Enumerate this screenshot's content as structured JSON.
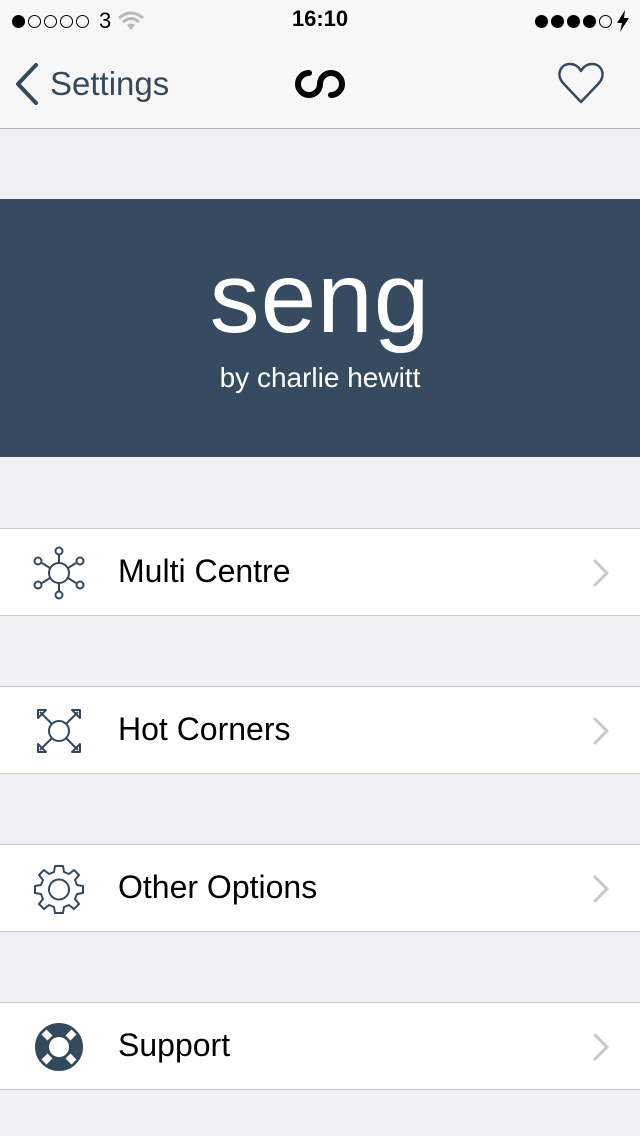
{
  "status_bar": {
    "signal_dots": [
      true,
      false,
      false,
      false,
      false
    ],
    "carrier": "3",
    "time": "16:10",
    "battery_dots": [
      true,
      true,
      true,
      true,
      false
    ],
    "icons": [
      "wifi-icon",
      "charging-bolt-icon"
    ]
  },
  "nav": {
    "back_label": "Settings",
    "logo": "seng-logo",
    "action_icon": "heart-icon"
  },
  "hero": {
    "title": "seng",
    "subtitle": "by charlie hewitt"
  },
  "menu": [
    {
      "label": "Multi Centre",
      "icon": "hub-icon"
    },
    {
      "label": "Hot Corners",
      "icon": "corners-arrows-icon"
    },
    {
      "label": "Other Options",
      "icon": "gear-icon"
    },
    {
      "label": "Support",
      "icon": "lifebuoy-icon"
    }
  ],
  "colors": {
    "accent": "#34495e",
    "hero_bg": "#364a60",
    "background": "#efeff4"
  }
}
